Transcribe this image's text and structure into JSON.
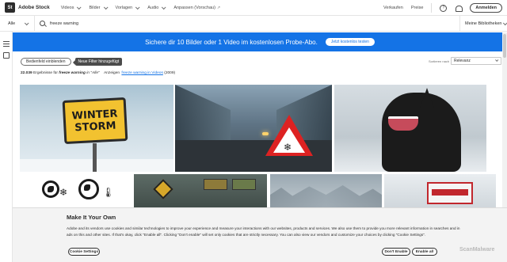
{
  "header": {
    "logo_mark": "St",
    "logo_text": "Adobe Stock",
    "nav": [
      {
        "label": "Videos"
      },
      {
        "label": "Bilder"
      },
      {
        "label": "Vorlagen"
      },
      {
        "label": "Audio"
      },
      {
        "label": "Anpassen (Vorschau)"
      }
    ],
    "sell_label": "Verkaufen",
    "pricing_label": "Preise",
    "help_glyph": "?",
    "signin_label": "Anmelden"
  },
  "search": {
    "category": "Alle",
    "query": "freeze warning",
    "libraries_label": "Meine Bibliotheken"
  },
  "banner": {
    "text": "Sichere dir 10 Bilder oder 1 Video im kostenlosen Probe-Abo.",
    "button": "Jetzt kostenlos testen"
  },
  "filters": {
    "toggle_label": "Bedienfeld einblenden",
    "tooltip": "Neue Filter hinzugefügt",
    "sort_label": "Sortieren nach",
    "sort_value": "Relevanz"
  },
  "results": {
    "count": "22.039",
    "text_before": "Ergebnisse für",
    "query": "freeze warning",
    "scope": "in \"Alle\"",
    "show_label": "Anzeigen",
    "videos_link": "freeze warning in Videos",
    "videos_count": "(2009)"
  },
  "tiles": {
    "winter_sign_line1": "WINTER",
    "winter_sign_line2": "STORM"
  },
  "cookie": {
    "title": "Make It Your Own",
    "body": "Adobe and its vendors use cookies and similar technologies to improve your experience and measure your interactions with our websites, products and services. We also use them to provide you more relevant information in searches and in ads on this and other sites. If that's okay, click \"Enable all\". Clicking \"Don't enable\" will set only cookies that are strictly necessary. You can also view our vendors and customize your choices by clicking \"Cookie Settings\".",
    "settings_label": "Cookie Settings",
    "disable_label": "Don't Enable",
    "enable_label": "Enable all"
  },
  "watermark": "ScanMalware",
  "colors": {
    "brand_blue": "#1473e6",
    "cookie_bg": "#f3f3f3"
  },
  "icons": [
    "search-icon",
    "help-icon",
    "bell-icon",
    "filter-icon",
    "library-icon",
    "external-link-icon",
    "chevron-down-icon"
  ]
}
